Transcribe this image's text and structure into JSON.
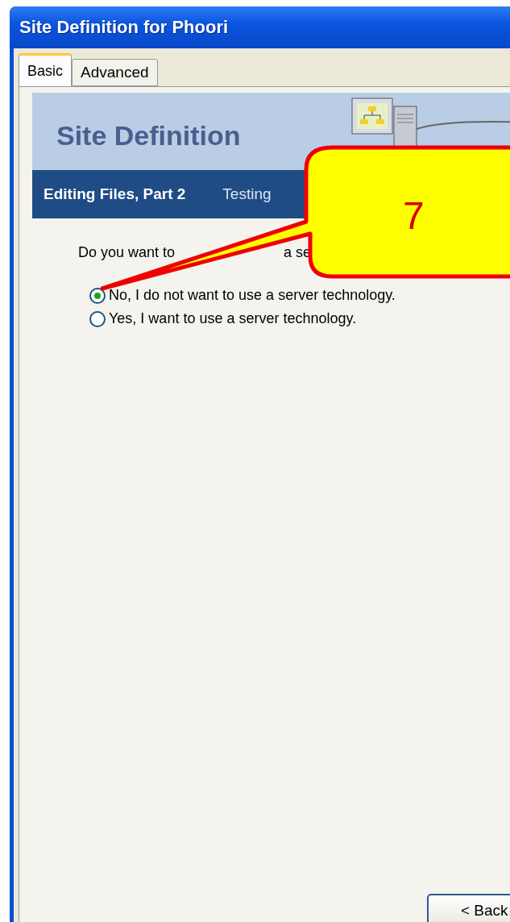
{
  "window": {
    "title": "Site Definition for Phoori"
  },
  "tabs": [
    {
      "label": "Basic",
      "selected": true
    },
    {
      "label": "Advanced",
      "selected": false
    }
  ],
  "header": {
    "title": "Site Definition"
  },
  "steps": [
    {
      "label": "Editing Files, Part 2",
      "selected": true
    },
    {
      "label": "Testing",
      "selected": false
    }
  ],
  "question_fragments": [
    "Do you want to",
    "a se"
  ],
  "options": [
    {
      "label": "No, I do not want to use a server technology.",
      "selected": true
    },
    {
      "label": "Yes, I want to use a server technology.",
      "selected": false
    }
  ],
  "callout": {
    "number": "7"
  },
  "buttons": [
    "< Back"
  ]
}
